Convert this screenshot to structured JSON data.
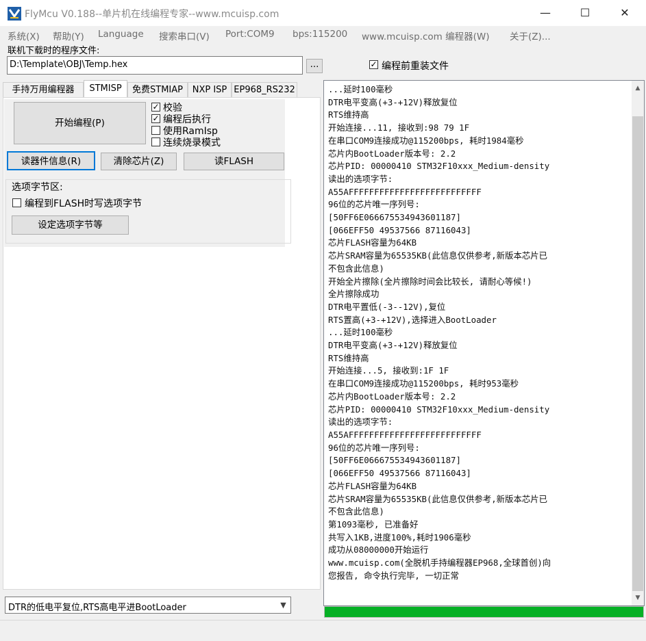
{
  "window": {
    "title": "FlyMcu V0.188--单片机在线编程专家--www.mcuisp.com",
    "controls": [
      "—",
      "☐",
      "✕"
    ]
  },
  "menu": [
    "系统(X)",
    "帮助(Y)",
    "Language",
    "搜索串口(V)",
    "Port:COM9",
    "bps:115200",
    "www.mcuisp.com 编程器(W)",
    "关于(Z)..."
  ],
  "program_file": {
    "label": "联机下载时的程序文件:",
    "path": "D:\\Template\\OBJ\\Temp.hex",
    "browse_label": "...",
    "reload_label": "编程前重装文件",
    "reload_checked": true
  },
  "tabs": [
    "手持万用编程器",
    "STMISP",
    "免费STMIAP",
    "NXP ISP",
    "EP968_RS232"
  ],
  "active_tab": 1,
  "stmisp": {
    "start_label": "开始编程(P)",
    "options": [
      {
        "label": "校验",
        "checked": true
      },
      {
        "label": "编程后执行",
        "checked": true
      },
      {
        "label": "使用RamIsp",
        "checked": false
      },
      {
        "label": "连续烧录模式",
        "checked": false
      }
    ],
    "read_info_label": "读器件信息(R)",
    "erase_label": "清除芯片(Z)",
    "read_flash_label": "读FLASH",
    "option_group_label": "选项字节区:",
    "write_option_label": "编程到FLASH时写选项字节",
    "write_option_checked": false,
    "set_option_label": "设定选项字节等"
  },
  "reset_mode": "DTR的低电平复位,RTS高电平进BootLoader",
  "progress_percent": 100,
  "log_lines": [
    "...延时100毫秒",
    "DTR电平变高(+3-+12V)释放复位",
    "RTS维持高",
    "开始连接...11, 接收到:98 79 1F",
    "在串口COM9连接成功@115200bps, 耗时1984毫秒",
    "芯片内BootLoader版本号: 2.2",
    "芯片PID: 00000410  STM32F10xxx_Medium-density",
    "读出的选项字节:",
    "A55AFFFFFFFFFFFFFFFFFFFFFFFFFF",
    "96位的芯片唯一序列号:",
    "[50FF6E066675534943601187]",
    "[066EFF50 49537566 87116043]",
    "芯片FLASH容量为64KB",
    "芯片SRAM容量为65535KB(此信息仅供参考,新版本芯片已",
    "不包含此信息)",
    "开始全片擦除(全片擦除时间会比较长, 请耐心等候!)",
    "全片擦除成功",
    "DTR电平置低(-3--12V),复位",
    "RTS置高(+3-+12V),选择进入BootLoader",
    "...延时100毫秒",
    "DTR电平变高(+3-+12V)释放复位",
    "RTS维持高",
    "开始连接...5, 接收到:1F 1F",
    "在串口COM9连接成功@115200bps, 耗时953毫秒",
    "芯片内BootLoader版本号: 2.2",
    "芯片PID: 00000410  STM32F10xxx_Medium-density",
    "读出的选项字节:",
    "A55AFFFFFFFFFFFFFFFFFFFFFFFFFF",
    "96位的芯片唯一序列号:",
    "[50FF6E066675534943601187]",
    "[066EFF50 49537566 87116043]",
    "芯片FLASH容量为64KB",
    "芯片SRAM容量为65535KB(此信息仅供参考,新版本芯片已",
    "不包含此信息)",
    "第1093毫秒, 已准备好",
    "共写入1KB,进度100%,耗时1906毫秒",
    "成功从08000000开始运行",
    "www.mcuisp.com(全脱机手持编程器EP968,全球首创)向",
    "您报告, 命令执行完毕, 一切正常"
  ],
  "colors": {
    "progress": "#06b025",
    "focus_border": "#0078d7"
  }
}
